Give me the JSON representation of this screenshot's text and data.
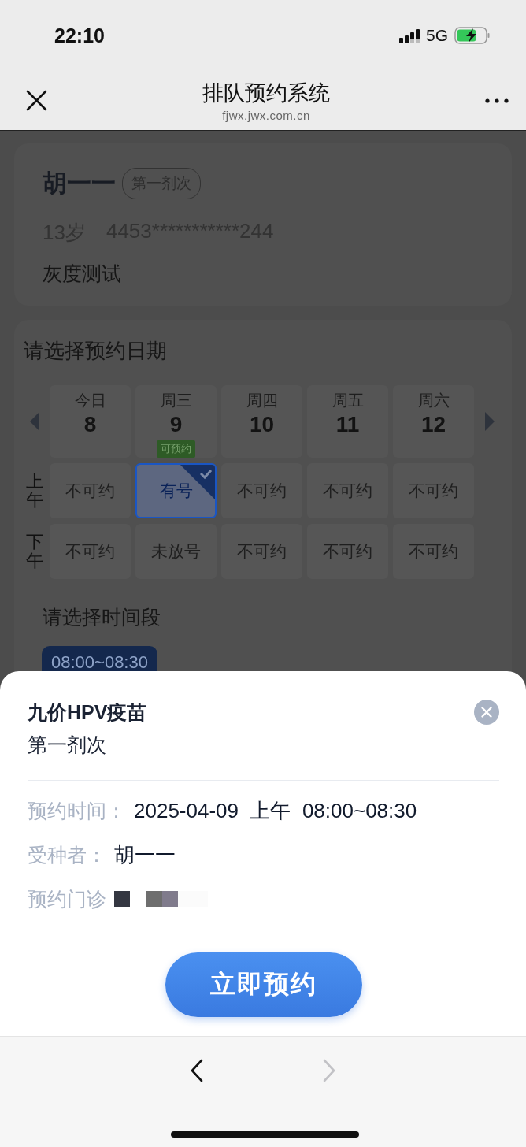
{
  "status_bar": {
    "time": "22:10",
    "network": "5G"
  },
  "nav_bar": {
    "title": "排队预约系统",
    "url": "fjwx.jwx.com.cn"
  },
  "patient": {
    "name": "胡一一",
    "dose_tag": "第一剂次",
    "age": "13岁",
    "id_number": "4453***********244",
    "note": "灰度测试"
  },
  "date_picker": {
    "title": "请选择预约日期",
    "days": [
      {
        "weekday": "今日",
        "date": "8"
      },
      {
        "weekday": "周三",
        "date": "9",
        "badge": "可预约"
      },
      {
        "weekday": "周四",
        "date": "10"
      },
      {
        "weekday": "周五",
        "date": "11"
      },
      {
        "weekday": "周六",
        "date": "12"
      }
    ],
    "periods": [
      {
        "label": "上午",
        "slots": [
          {
            "text": "不可约",
            "kind": "unavailable",
            "selected": false
          },
          {
            "text": "有号",
            "kind": "available",
            "selected": true
          },
          {
            "text": "不可约",
            "kind": "unavailable",
            "selected": false
          },
          {
            "text": "不可约",
            "kind": "unavailable",
            "selected": false
          },
          {
            "text": "不可约",
            "kind": "unavailable",
            "selected": false
          }
        ]
      },
      {
        "label": "下午",
        "slots": [
          {
            "text": "不可约",
            "kind": "unavailable",
            "selected": false
          },
          {
            "text": "未放号",
            "kind": "unavailable",
            "selected": false
          },
          {
            "text": "不可约",
            "kind": "unavailable",
            "selected": false
          },
          {
            "text": "不可约",
            "kind": "unavailable",
            "selected": false
          },
          {
            "text": "不可约",
            "kind": "unavailable",
            "selected": false
          }
        ]
      }
    ],
    "time_title": "请选择时间段",
    "time_slots": [
      {
        "text": "08:00~08:30",
        "selected": true
      }
    ]
  },
  "sheet": {
    "title": "九价HPV疫苗",
    "subtitle": "第一剂次",
    "rows": [
      {
        "label": "预约时间：",
        "value": "2025-04-09  上午  08:00~08:30",
        "kind": "text"
      },
      {
        "label": "受种者：",
        "value": "胡一一",
        "kind": "text"
      },
      {
        "label": "预约门诊",
        "kind": "redacted"
      }
    ],
    "button": "立即预约"
  },
  "toolbar": {
    "back": {
      "disabled": false
    },
    "forward": {
      "disabled": true
    }
  }
}
